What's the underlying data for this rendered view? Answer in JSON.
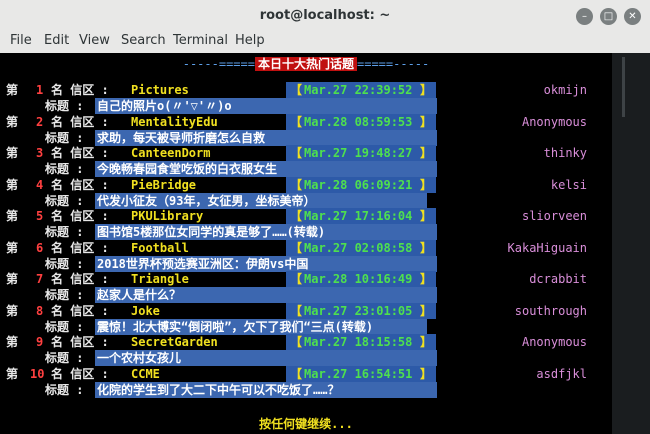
{
  "window": {
    "title": "root@localhost: ~"
  },
  "menu": [
    "File",
    "Edit",
    "View",
    "Search",
    "Terminal",
    "Help"
  ],
  "header": {
    "left": "-----=====",
    "title": "本日十大热门话题",
    "right": "=====-----"
  },
  "labels": {
    "rank_prefix": "第",
    "board": "名 信区 :",
    "subject": "标题 :"
  },
  "posts": [
    {
      "rank": "1",
      "board": "Pictures",
      "date": "Mar.27 22:39:52",
      "author": "okmijn",
      "title": "自己的照片o(〃'▽'〃)o"
    },
    {
      "rank": "2",
      "board": "MentalityEdu",
      "date": "Mar.28 08:59:53",
      "author": "Anonymous",
      "title": "求助，每天被导师折磨怎么自救"
    },
    {
      "rank": "3",
      "board": "CanteenDorm",
      "date": "Mar.27 19:48:27",
      "author": "thinky",
      "title": "今晚畅春园食堂吃饭的白衣服女生"
    },
    {
      "rank": "4",
      "board": "PieBridge",
      "date": "Mar.28 06:09:21",
      "author": "kelsi",
      "title": "代发小征友（93年，女征男，坐标美帝）"
    },
    {
      "rank": "5",
      "board": "PKULibrary",
      "date": "Mar.27 17:16:04",
      "author": "sliorveen",
      "title": "图书馆5楼那位女同学的真是够了……(转载)"
    },
    {
      "rank": "6",
      "board": "Football",
      "date": "Mar.27 02:08:58",
      "author": "KakaHiguain",
      "title": "2018世界杯预选赛亚洲区：伊朗vs中国"
    },
    {
      "rank": "7",
      "board": "Triangle",
      "date": "Mar.28 10:16:49",
      "author": "dcrabbit",
      "title": "赵家人是什么？"
    },
    {
      "rank": "8",
      "board": "Joke",
      "date": "Mar.27 23:01:05",
      "author": "southrough",
      "title": "震惊！北大博实“倒闭啦”，欠下了我们“三点(转载)"
    },
    {
      "rank": "9",
      "board": "SecretGarden",
      "date": "Mar.27 18:15:58",
      "author": "Anonymous",
      "title": "一个农村女孩儿"
    },
    {
      "rank": "10",
      "board": "CCME",
      "date": "Mar.27 16:54:51",
      "author": "asdfjkl",
      "title": "化院的学生到了大二下中午可以不吃饭了……？"
    }
  ],
  "footer": "按任何键继续...",
  "colors": {
    "accent_blue": "#3c67b0",
    "title_red": "#c01010"
  }
}
